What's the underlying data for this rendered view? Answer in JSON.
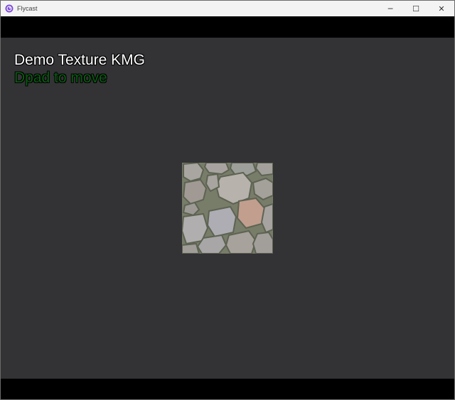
{
  "window": {
    "title": "Flycast",
    "app_icon": "flycast-logo-icon",
    "controls": {
      "minimize_icon": "minimize-icon",
      "maximize_icon": "maximize-icon",
      "close_icon": "close-icon",
      "minimize_glyph": "─",
      "maximize_glyph": "☐",
      "close_glyph": "✕"
    }
  },
  "game": {
    "title": "Demo Texture KMG",
    "hint": "Dpad to move",
    "texture": "cobblestone-texture"
  },
  "colors": {
    "game_background": "#333235",
    "title_text": "#ffffff",
    "hint_text": "#0a5c12",
    "letterbox": "#000000",
    "titlebar": "#f3f3f3"
  }
}
